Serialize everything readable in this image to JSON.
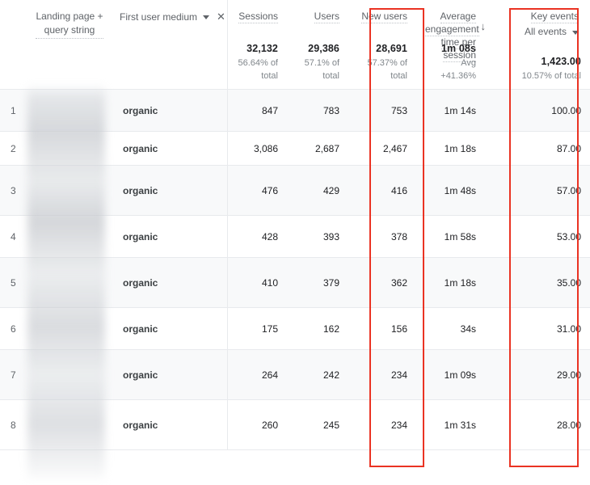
{
  "table": {
    "dimension_headers": [
      {
        "label": "Landing page +\nquery string",
        "line1": "Landing page +",
        "line2": "query string",
        "has_tooltip_underline": true
      },
      {
        "label": "First user medium",
        "has_caret": true,
        "has_close": true
      }
    ],
    "metric_headers": [
      {
        "name": "Sessions",
        "total": "32,132",
        "subtotal": "56.64% of total",
        "highlighted": false
      },
      {
        "name": "Users",
        "total": "29,386",
        "subtotal": "57.1% of total",
        "highlighted": false
      },
      {
        "name": "New users",
        "total": "28,691",
        "subtotal": "57.37% of total",
        "highlighted": true
      },
      {
        "name": "Average engagement time per session",
        "total": "1m 08s",
        "subtotal": "Avg +41.36%",
        "highlighted": false
      },
      {
        "name": "Key events",
        "selector": "All events",
        "total": "1,423.00",
        "subtotal": "10.57% of total",
        "highlighted": true,
        "sorted": true,
        "sort_direction": "descending"
      }
    ],
    "rows": [
      {
        "index": "1",
        "landing_page": "",
        "first_user_medium": "organic",
        "sessions": "847",
        "users": "783",
        "new_users": "753",
        "avg_engagement_time": "1m 14s",
        "key_events": "100.00"
      },
      {
        "index": "2",
        "landing_page": "",
        "first_user_medium": "organic",
        "sessions": "3,086",
        "users": "2,687",
        "new_users": "2,467",
        "avg_engagement_time": "1m 18s",
        "key_events": "87.00"
      },
      {
        "index": "3",
        "landing_page": "",
        "first_user_medium": "organic",
        "sessions": "476",
        "users": "429",
        "new_users": "416",
        "avg_engagement_time": "1m 48s",
        "key_events": "57.00"
      },
      {
        "index": "4",
        "landing_page": "",
        "first_user_medium": "organic",
        "sessions": "428",
        "users": "393",
        "new_users": "378",
        "avg_engagement_time": "1m 58s",
        "key_events": "53.00"
      },
      {
        "index": "5",
        "landing_page": "",
        "first_user_medium": "organic",
        "sessions": "410",
        "users": "379",
        "new_users": "362",
        "avg_engagement_time": "1m 18s",
        "key_events": "35.00"
      },
      {
        "index": "6",
        "landing_page": "",
        "first_user_medium": "organic",
        "sessions": "175",
        "users": "162",
        "new_users": "156",
        "avg_engagement_time": "34s",
        "key_events": "31.00"
      },
      {
        "index": "7",
        "landing_page": "",
        "first_user_medium": "organic",
        "sessions": "264",
        "users": "242",
        "new_users": "234",
        "avg_engagement_time": "1m 09s",
        "key_events": "29.00"
      },
      {
        "index": "8",
        "landing_page": "",
        "first_user_medium": "organic",
        "sessions": "260",
        "users": "245",
        "new_users": "234",
        "avg_engagement_time": "1m 31s",
        "key_events": "28.00"
      }
    ]
  },
  "icons": {
    "caret_down": "▾",
    "close": "✕",
    "sort_down_arrow": "↓"
  },
  "colors": {
    "highlight_red": "#ea3323",
    "text_primary": "#202124",
    "text_secondary": "#5f6368",
    "row_stripe": "#f8f9fa",
    "border": "#e8eaed"
  },
  "annotations": {
    "highlight_boxes": [
      {
        "target": "New users",
        "color": "#ea3323"
      },
      {
        "target": "Key events",
        "color": "#ea3323"
      }
    ]
  }
}
